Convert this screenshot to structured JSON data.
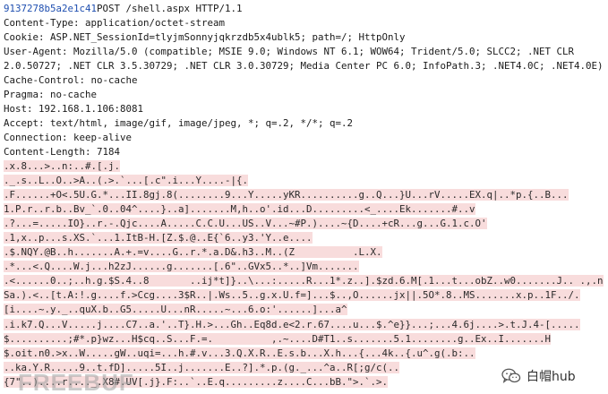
{
  "request_headers": {
    "request_line_hash": "9137278b5a2e1c41",
    "request_line_rest": "POST /shell.aspx HTTP/1.1",
    "lines": [
      "Content-Type: application/octet-stream",
      "Cookie: ASP.NET_SessionId=tlyjmSonnyjqkrzdb5x4ublk5; path=/; HttpOnly",
      "User-Agent: Mozilla/5.0 (compatible; MSIE 9.0; Windows NT 6.1; WOW64; Trident/5.0; SLCC2; .NET CLR",
      "2.0.50727; .NET CLR 3.5.30729; .NET CLR 3.0.30729; Media Center PC 6.0; InfoPath.3; .NET4.0C; .NET4.0E)",
      "Cache-Control: no-cache",
      "Pragma: no-cache",
      "Host: 192.168.1.106:8081",
      "Accept: text/html, image/gif, image/jpeg, *; q=.2, */*; q=.2",
      "Connection: keep-alive",
      "Content-Length: 7184"
    ]
  },
  "body_lines": [
    ".x.8...>..n:..#.[.j.",
    "._.s..L..O..>A..(.>.`...[.c\".i...Y....-|{.",
    ".F......+O<.5U.G.*...II.8gj.8(........9...Y.....yKR..........g..Q...}U...rV.....EX.q|..*p.{..B...",
    "1.P.r..r.b..Bv_`.0..04^....}..a].......M,h..o'.id...D.........<_....Ek.......#..v",
    ".?...=.....IO}..r.-.Qjc....A.....C.C.U...US..V...~#P.)....~{D....+cR...g...G.1.c.O'",
    ".1,x..p...s.XS.`...1.ItB-H.[Z.$.@..E{`6..y3.'Y..e....",
    ".$.NQY.@B..h.......A.+.=v....G..r.*.a.D&.h3..M..(Z          .L.X.",
    ".*...<.Q....W.j...h2zJ......g.......[.6\"..GVx5..*..]Vm.......",
    ".<......0..;..h.g.$S.4..8       ..ij*t]}..\\...:.....R...1*.z..].$zd.6.M[.1...t...obZ..w0.......J.. .,.n",
    "Sa.).<..[t.A:!.g....f.>Ccg....3$R..|.Ws..5..g.x.U.f=]...$..,O......jx||.5O*.8..MS.......x.p..1F../.",
    "[i....~.y._..quX.b..G5.....U...nR.....~...6.o:'......]...a^",
    ".i.k7.Q...V.....j....C7..a.'..T}.H.>...Gh..Eq8d.e<2.r.67....u...$.^e}}...;...4.6j....>.t.J.4-[.....",
    "$..........;#*.p}wz...H$cq..S...F.=.          ,.~....D#T1..s.......5.1........g..Ex..I.......H",
    "$.oit.n0.>x..W.....gW..uqi=...h.#.v...3.Q.X.R..E.s.b...X.h...{...4k..{.u^.g(.b:..",
    "..ka.Y.R.....9..t.fD].....5I..j.......E..?].*.p.(g._...^a..R[;g/c(..",
    "{7\"..)....r...._.X8#.UV[.j}.F:..`..E.q.........z....C...bB.\">.`.>."
  ],
  "watermark_left": "FREEBUF",
  "watermark_brand": {
    "icon": "wechat-icon",
    "text": "白帽hub"
  }
}
